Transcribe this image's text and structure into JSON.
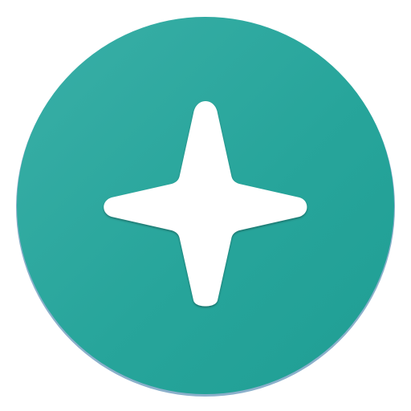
{
  "icon": {
    "name": "sparkle-app-icon",
    "symbol": "four-point-star-icon",
    "background_color_light": "#3AAFA7",
    "background_color": "#27A59B",
    "background_color_dark": "#1F9E94",
    "rim_color": "#2C6FA0",
    "symbol_color": "#FFFFFF"
  }
}
